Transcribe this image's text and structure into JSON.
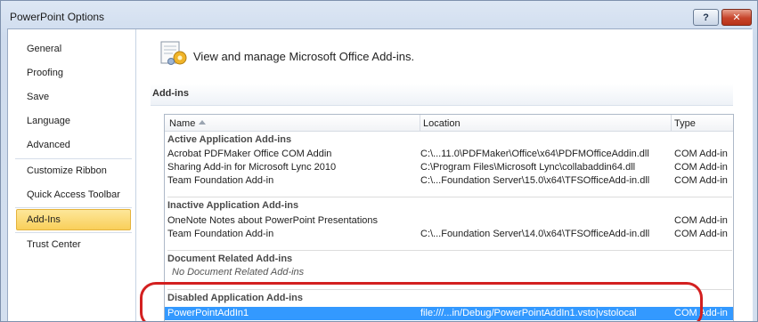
{
  "window": {
    "title": "PowerPoint Options",
    "help_label": "?",
    "close_label": "✕"
  },
  "nav": {
    "items": [
      {
        "label": "General"
      },
      {
        "label": "Proofing"
      },
      {
        "label": "Save"
      },
      {
        "label": "Language"
      },
      {
        "label": "Advanced"
      },
      {
        "label": "Customize Ribbon"
      },
      {
        "label": "Quick Access Toolbar"
      },
      {
        "label": "Add-Ins"
      },
      {
        "label": "Trust Center"
      }
    ],
    "selected": "Add-Ins"
  },
  "content": {
    "header_icon": "addins-gear-icon",
    "header_text": "View and manage Microsoft Office Add-ins.",
    "section_title": "Add-ins",
    "columns": {
      "name": "Name",
      "location": "Location",
      "type": "Type"
    },
    "groups": [
      {
        "title": "Active Application Add-ins",
        "rows": [
          {
            "name": "Acrobat PDFMaker Office COM Addin",
            "location": "C:\\...11.0\\PDFMaker\\Office\\x64\\PDFMOfficeAddin.dll",
            "type": "COM Add-in"
          },
          {
            "name": "Sharing Add-in for Microsoft Lync 2010",
            "location": "C:\\Program Files\\Microsoft Lync\\collabaddin64.dll",
            "type": "COM Add-in"
          },
          {
            "name": "Team Foundation Add-in",
            "location": "C:\\...Foundation Server\\15.0\\x64\\TFSOfficeAdd-in.dll",
            "type": "COM Add-in"
          }
        ]
      },
      {
        "title": "Inactive Application Add-ins",
        "rows": [
          {
            "name": "OneNote Notes about PowerPoint Presentations",
            "location": "",
            "type": "COM Add-in"
          },
          {
            "name": "Team Foundation Add-in",
            "location": "C:\\...Foundation Server\\14.0\\x64\\TFSOfficeAdd-in.dll",
            "type": "COM Add-in"
          }
        ]
      },
      {
        "title": "Document Related Add-ins",
        "empty_note": "No Document Related Add-ins"
      },
      {
        "title": "Disabled Application Add-ins",
        "rows": [
          {
            "name": "PowerPointAddIn1",
            "location": "file:///...in/Debug/PowerPointAddIn1.vsto|vstolocal",
            "type": "COM Add-in"
          }
        ]
      }
    ]
  },
  "colors": {
    "selected_nav": "#f9cf5a",
    "selected_row": "#3399ff",
    "annotation_ring": "#d32020"
  }
}
